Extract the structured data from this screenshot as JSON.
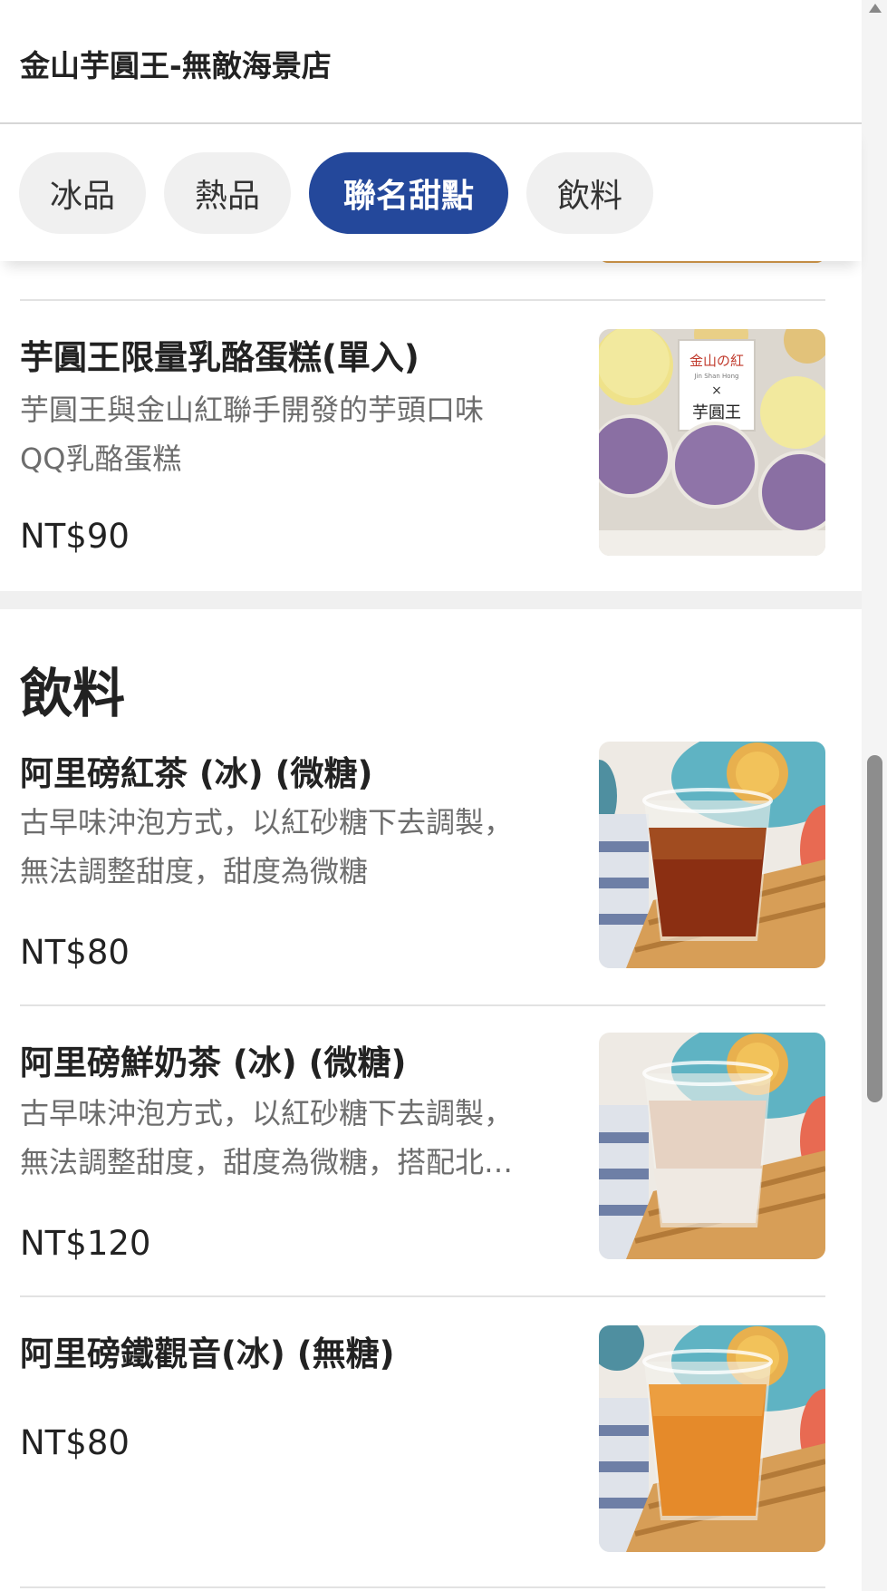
{
  "header": {
    "store_name": "金山芋圓王-無敵海景店"
  },
  "tabs": [
    {
      "label": "冰品",
      "active": false
    },
    {
      "label": "熱品",
      "active": false
    },
    {
      "label": "聯名甜點",
      "active": true
    },
    {
      "label": "飲料",
      "active": false
    }
  ],
  "items_top": [
    {
      "name": "芋圓王限量乳酪蛋糕(單入)",
      "desc_lines": [
        "芋圓王與金山紅聯手開發的芋頭口味",
        "QQ乳酪蛋糕"
      ],
      "price": "NT$90",
      "image": "cheesecake-box-image",
      "image_text": {
        "brand": "金山の紅",
        "sub": "Jin Shan Hong",
        "cross": "×",
        "partner": "芋圓王"
      }
    }
  ],
  "section": {
    "title": "飲料"
  },
  "items_drinks": [
    {
      "name": "阿里磅紅茶 (冰) (微糖)",
      "desc_lines": [
        "古早味沖泡方式，以紅砂糖下去調製，",
        "無法調整甜度，甜度為微糖"
      ],
      "price": "NT$80",
      "image": "iced-black-tea-image"
    },
    {
      "name": "阿里磅鮮奶茶 (冰) (微糖)",
      "desc_lines": [
        "古早味沖泡方式，以紅砂糖下去調製，",
        "無法調整甜度，甜度為微糖，搭配北…"
      ],
      "price": "NT$120",
      "image": "iced-milk-tea-image"
    },
    {
      "name": "阿里磅鐵觀音(冰) (無糖)",
      "desc_lines": [],
      "price": "NT$80",
      "image": "iced-oolong-tea-image"
    }
  ],
  "colors": {
    "accent": "#24489b",
    "tab_bg": "#f0f0f0",
    "text": "#222222",
    "muted": "#6d6d6d"
  }
}
